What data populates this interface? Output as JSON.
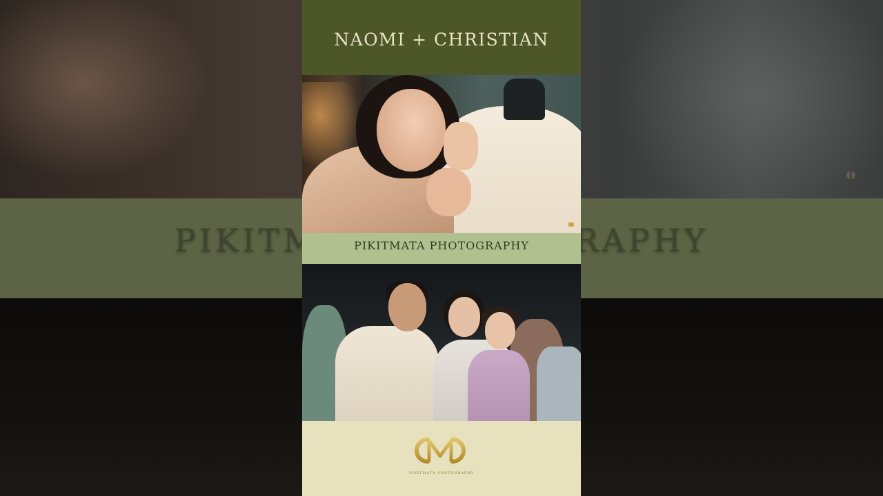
{
  "title": "NAOMI + CHRISTIAN",
  "credit": "PIKITMATA PHOTOGRAPHY",
  "background_band_text": "PIKITMATA PHOTOGRAPHY",
  "logo": {
    "subtitle": "PIKITMATA PHOTOGRAPHY"
  },
  "colors": {
    "title_bar": "#4d5627",
    "credit_bar": "#b1c08f",
    "logo_area": "#e7e1bd",
    "logo_gold": "#c9a64a"
  }
}
